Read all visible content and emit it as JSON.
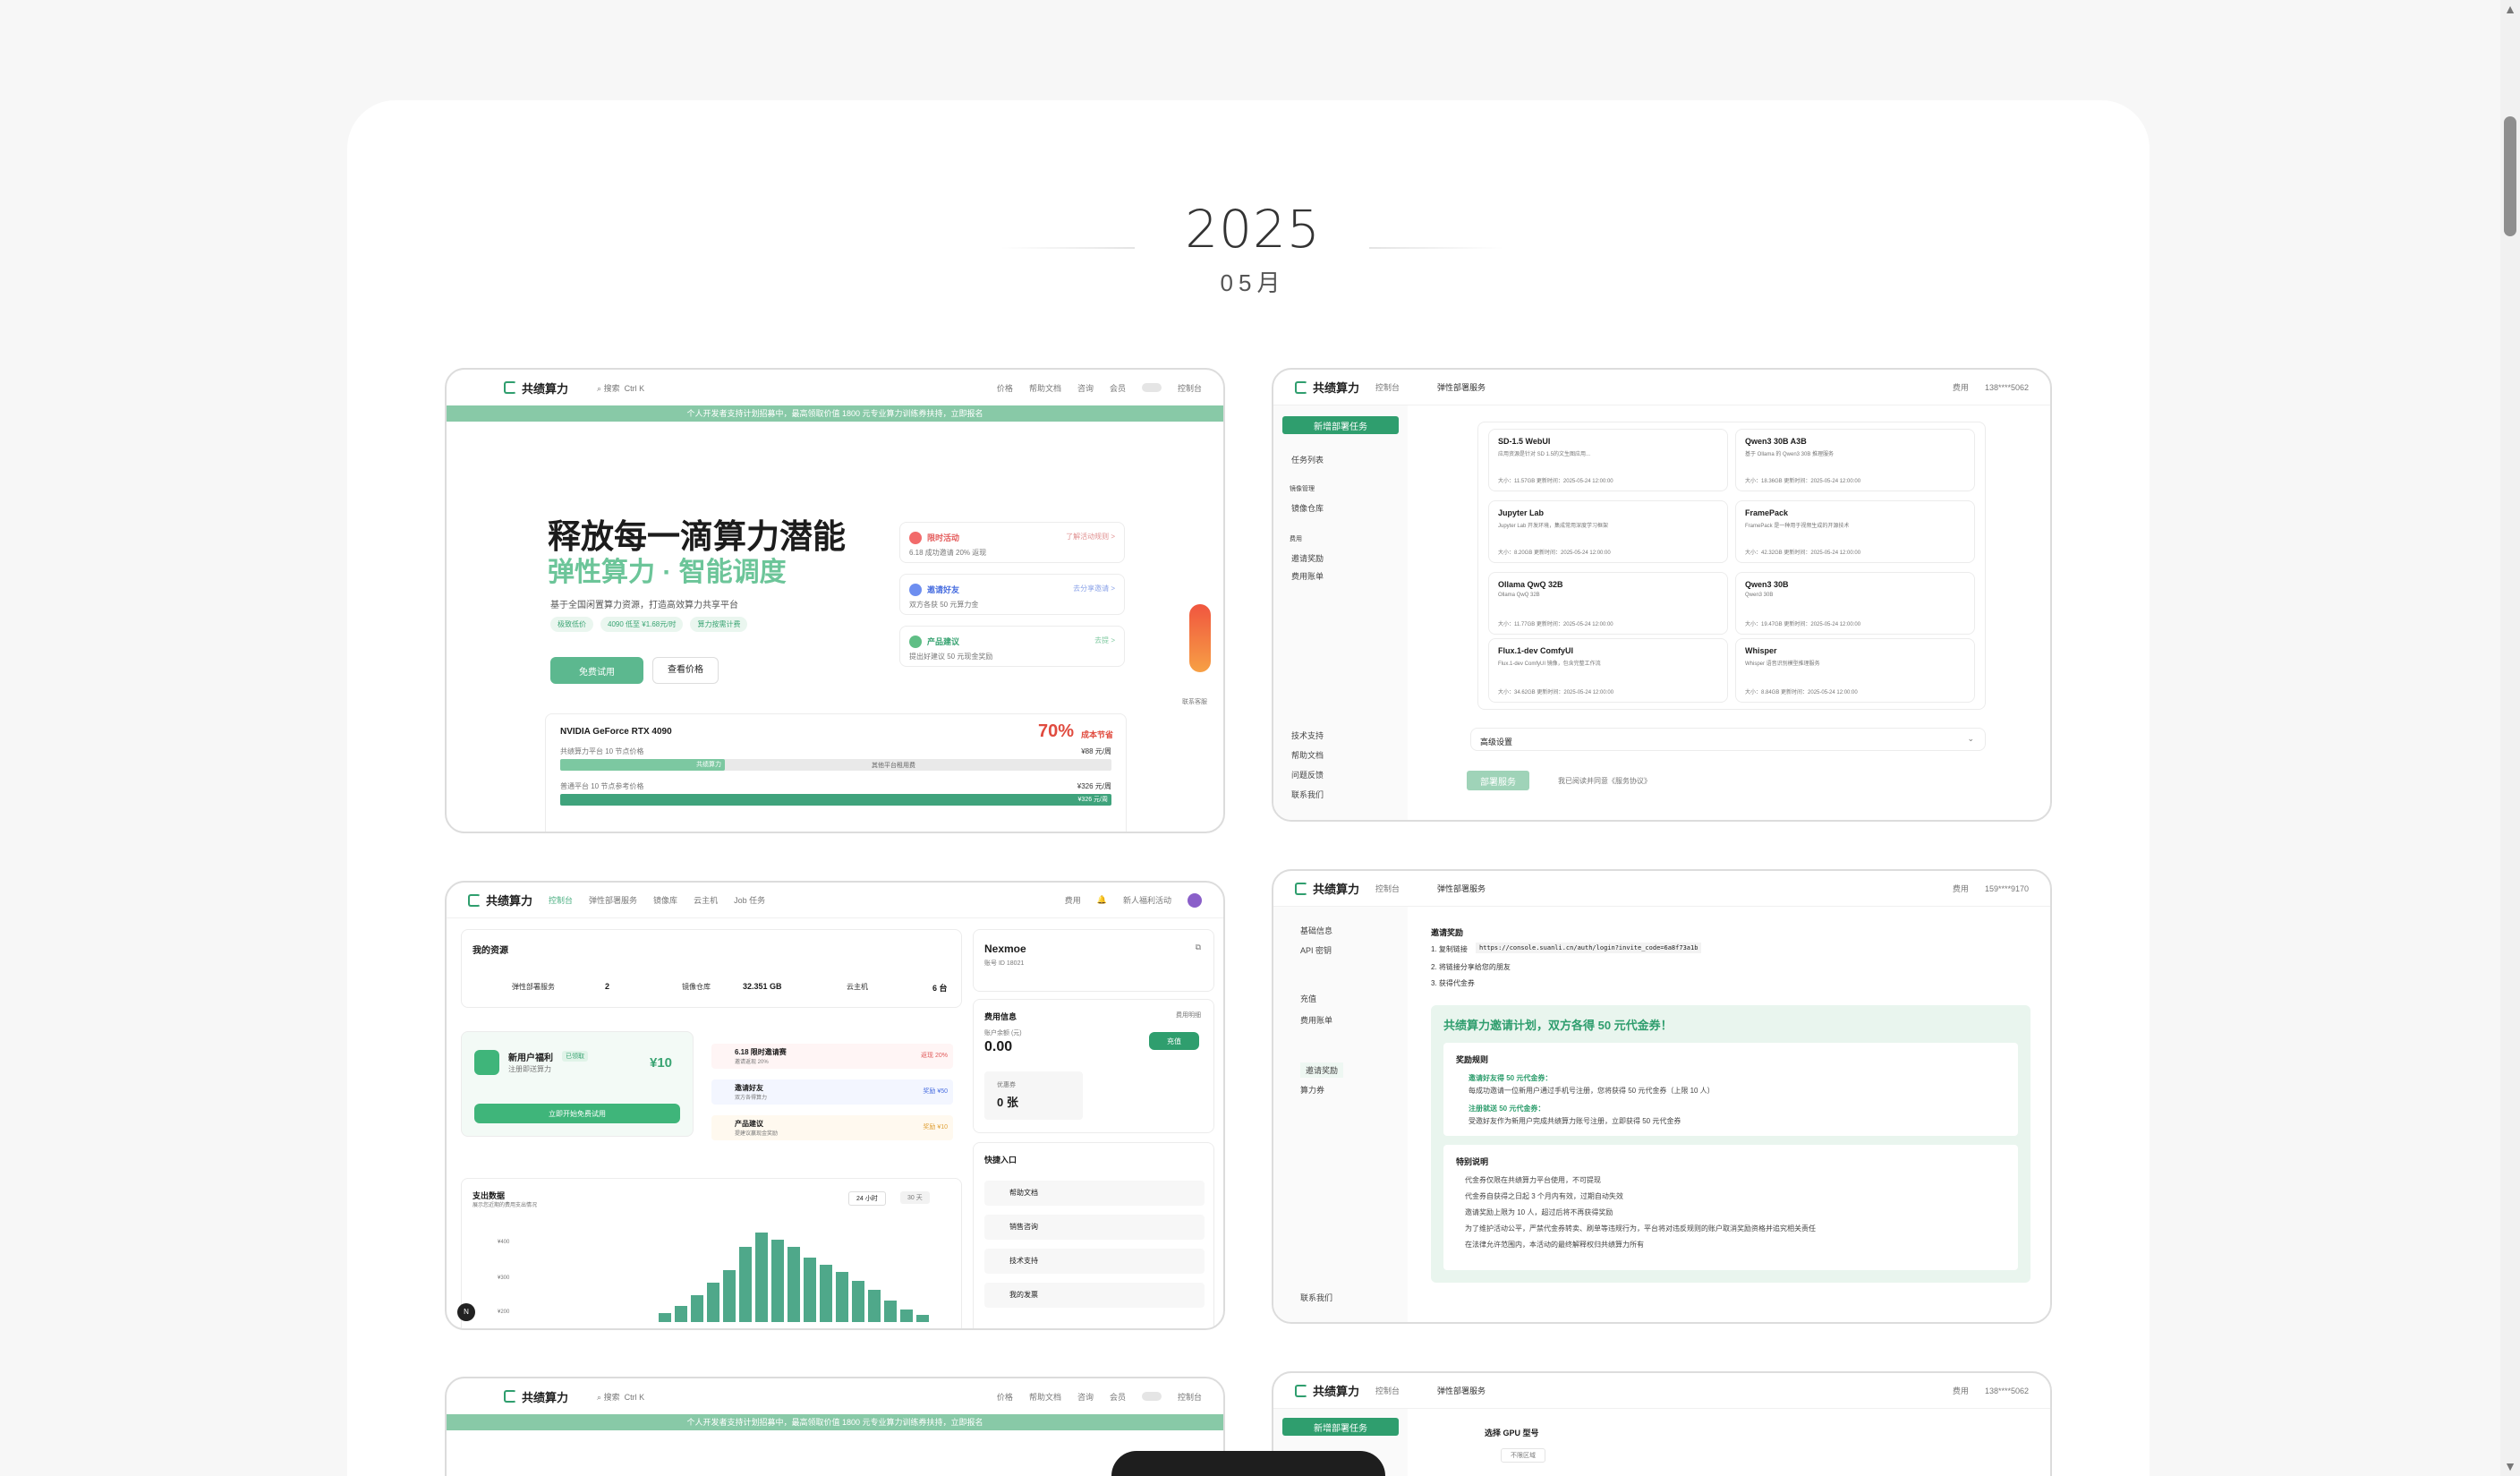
{
  "timeline": {
    "year": "2025",
    "month": "05月"
  },
  "shot1": {
    "brand": "共绩算力",
    "search": "搜索",
    "search_kbd": "Ctrl K",
    "nav": [
      "价格",
      "帮助文档",
      "咨询",
      "会员"
    ],
    "login": "控制台",
    "banner": "个人开发者支持计划招募中，最高领取价值 1800 元专业算力训练券扶持，立即报名",
    "h1": "释放每一滴算力潜能",
    "h2": "弹性算力 · 智能调度",
    "sub": "基于全国闲置算力资源，打造高效算力共享平台",
    "tags": [
      "极致低价",
      "4090 低至 ¥1.68元/时",
      "算力按需计费"
    ],
    "cta_primary": "免费试用",
    "cta_secondary": "查看价格",
    "promo": [
      {
        "title": "限时活动",
        "desc": "6.18 成功邀请 20% 返现",
        "link": "了解活动规则 >"
      },
      {
        "title": "邀请好友",
        "desc": "双方各获 50 元算力金",
        "link": "去分享邀请 >"
      },
      {
        "title": "产品建议",
        "desc": "提出好建议 50 元现金奖励",
        "link": "去提 >"
      }
    ],
    "float_label": "联系客服",
    "gpu_name": "NVIDIA GeForce RTX 4090",
    "gpu_save": "70%",
    "gpu_save_label": "成本节省",
    "row1_label": "共绩算力平台 10 节点价格",
    "row1_value": "¥88 元/周",
    "row1_chip": "共绩算力",
    "row1_mid": "其他平台租用费",
    "row2_label": "普通平台 10 节点参考价格",
    "row2_value": "¥326 元/周",
    "row2_chip": "¥326 元/周"
  },
  "shot2": {
    "brand": "共绩算力",
    "console": "控制台",
    "section": "弹性部署服务",
    "hdr_right": [
      "费用",
      "138****5062"
    ],
    "new_task": "新增部署任务",
    "side": [
      "任务列表",
      "镜像管理",
      "镜像仓库",
      "费用",
      "邀请奖励",
      "费用账单",
      "技术支持",
      "帮助文档",
      "问题反馈",
      "联系我们"
    ],
    "apps": [
      {
        "name": "SD-1.5 WebUI",
        "desc": "应用资源是针对 SD 1.5的文生图应用...",
        "meta": "大小：11.57GB  更新时间：2025-05-24 12:00:00"
      },
      {
        "name": "Qwen3 30B A3B",
        "desc": "基于 Ollama 的 Qwen3 30B 推理服务",
        "meta": "大小：18.36GB  更新时间：2025-05-24 12:00:00"
      },
      {
        "name": "Jupyter Lab",
        "desc": "Jupyter Lab 开发环境，集成常用深度学习框架",
        "meta": "大小：8.20GB  更新时间：2025-05-24 12:00:00"
      },
      {
        "name": "FramePack",
        "desc": "FramePack 是一种用于视频生成的开源技术",
        "meta": "大小：42.32GB  更新时间：2025-05-24 12:00:00"
      },
      {
        "name": "Ollama QwQ 32B",
        "desc": "Ollama QwQ 32B",
        "meta": "大小：11.77GB  更新时间：2025-05-24 12:00:00"
      },
      {
        "name": "Qwen3 30B",
        "desc": "Qwen3 30B",
        "meta": "大小：19.47GB  更新时间：2025-05-24 12:00:00"
      },
      {
        "name": "Flux.1-dev ComfyUI",
        "desc": "Flux.1-dev ComfyUI 镜像，包含完整工作流",
        "meta": "大小：34.62GB  更新时间：2025-05-24 12:00:00"
      },
      {
        "name": "Whisper",
        "desc": "Whisper 语音识别模型推理服务",
        "meta": "大小：8.84GB  更新时间：2025-05-24 12:00:00"
      }
    ],
    "advanced": "高级设置",
    "deploy": "部署服务",
    "agree": "我已阅读并同意《服务协议》"
  },
  "shot3": {
    "brand": "共绩算力",
    "nav": [
      "控制台",
      "弹性部署服务",
      "镜像库",
      "云主机",
      "Job 任务"
    ],
    "hdr_right": [
      "费用",
      "通知",
      "新人福利活动"
    ],
    "res_title": "我的资源",
    "res": [
      {
        "label": "弹性部署服务",
        "value": "2"
      },
      {
        "label": "镜像仓库",
        "value": "32.351 GB"
      },
      {
        "label": "云主机",
        "value": "6 台"
      }
    ],
    "welfare_title": "新用户福利",
    "welfare_tag": "已领取",
    "welfare_sub": "注册即送算力",
    "welfare_amount": "¥10",
    "welfare_btn": "立即开始免费试用",
    "acts": [
      {
        "title": "6.18 限时邀请赛",
        "desc": "邀请返现 20%",
        "tag": "返现 20%"
      },
      {
        "title": "邀请好友",
        "desc": "双方各得算力",
        "tag": "奖励 ¥50"
      },
      {
        "title": "产品建议",
        "desc": "提建议赢现金奖励",
        "tag": "奖励 ¥10"
      }
    ],
    "chart_title": "支出数据",
    "chart_sub": "展示您近期的费用支出情况",
    "chart_tabs": [
      "24 小时",
      "30 天"
    ],
    "y_ticks": [
      "¥400",
      "¥300",
      "¥200"
    ],
    "user": "Nexmoe",
    "user_id": "账号 ID 18021",
    "fee_title": "费用信息",
    "fee_link": "费用明细",
    "balance_label": "账户余额 (元)",
    "balance": "0.00",
    "recharge": "充值",
    "coupon_label": "优惠券",
    "coupon": "0 张",
    "quick_title": "快捷入口",
    "quick": [
      "帮助文档",
      "销售咨询",
      "技术支持",
      "我的发票"
    ],
    "avatar_letter": "N"
  },
  "shot4": {
    "brand": "共绩算力",
    "console": "控制台",
    "section": "弹性部署服务",
    "hdr_right": [
      "费用",
      "159****9170"
    ],
    "side": [
      "基础信息",
      "API 密钥",
      "充值",
      "费用账单",
      "邀请奖励",
      "算力券",
      "联系我们"
    ],
    "title": "邀请奖励",
    "steps": [
      "1. 复制链接",
      "2. 将链接分享给您的朋友",
      "3. 获得代金券"
    ],
    "link": "https://console.suanli.cn/auth/login?invite_code=6a8f73a1b",
    "plan": "共绩算力邀请计划，双方各得 50 元代金券！",
    "rules_title": "奖励规则",
    "rule1_title": "邀请好友得 50 元代金券：",
    "rule1": "每成功邀请一位新用户通过手机号注册，您将获得 50 元代金券（上限 10 人）",
    "rule2_title": "注册就送 50 元代金券：",
    "rule2": "受邀好友作为新用户完成共绩算力账号注册，立即获得 50 元代金券",
    "notes_title": "特别说明",
    "notes": [
      "代金券仅限在共绩算力平台使用，不可提现",
      "代金券自获得之日起 3 个月内有效，过期自动失效",
      "邀请奖励上限为 10 人，超过后将不再获得奖励",
      "为了维护活动公平，严禁代金券转卖、刷单等违规行为，平台将对违反规则的账户取消奖励资格并追究相关责任",
      "在法律允许范围内，本活动的最终解释权归共绩算力所有"
    ]
  },
  "shot5": {
    "brand": "共绩算力",
    "search": "搜索",
    "search_kbd": "Ctrl K",
    "nav": [
      "价格",
      "帮助文档",
      "咨询",
      "会员"
    ],
    "login": "控制台",
    "banner": "个人开发者支持计划招募中，最高领取价值 1800 元专业算力训练券扶持，立即报名"
  },
  "shot6": {
    "brand": "共绩算力",
    "console": "控制台",
    "section": "弹性部署服务",
    "hdr_right": [
      "费用",
      "138****5062"
    ],
    "new_task": "新增部署任务",
    "gpu_title": "选择 GPU 型号",
    "region": "不限区域"
  },
  "scroll": {
    "position": 0.08
  }
}
